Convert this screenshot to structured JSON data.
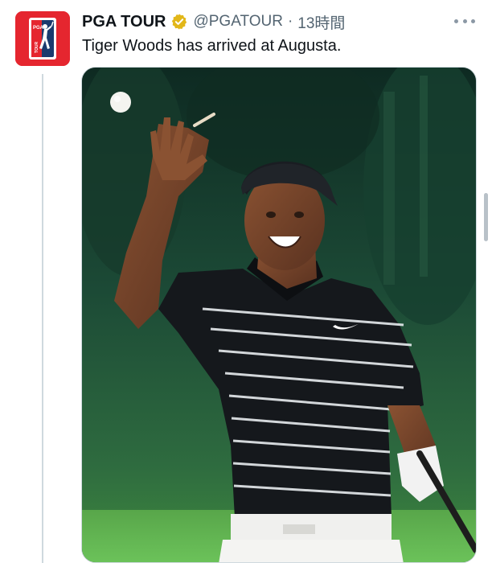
{
  "tweet": {
    "display_name": "PGA TOUR",
    "verified": true,
    "handle": "@PGATOUR",
    "separator": "·",
    "time": "13時間",
    "text": "Tiger Woods has arrived at Augusta.",
    "media": {
      "type": "photo",
      "subject": "golfer tossing a golf ball"
    }
  },
  "avatar": {
    "logo_text": "PGA TOUR",
    "brand_color": "#e5262f",
    "navy": "#1a3a6e"
  },
  "icons": {
    "verified": "verified-badge-icon",
    "more": "more-options-icon"
  },
  "colors": {
    "text_primary": "#0f1419",
    "text_secondary": "#536471",
    "verified_gold": "#e2b719",
    "divider": "#cfd9de"
  }
}
